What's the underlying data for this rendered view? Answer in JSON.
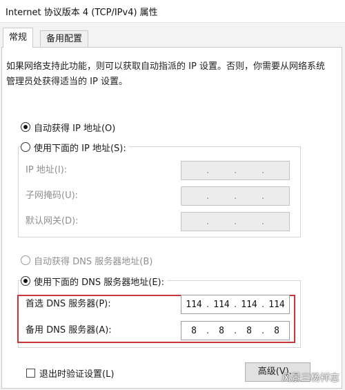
{
  "window": {
    "title": "Internet 协议版本 4 (TCP/IPv4) 属性"
  },
  "tabs": [
    {
      "label": "常规"
    },
    {
      "label": "备用配置"
    }
  ],
  "description": "如果网络支持此功能，则可以获取自动指派的 IP 设置。否则，你需要从网络系统管理员处获得适当的 IP 设置。",
  "ip_section": {
    "auto_label": "自动获得 IP 地址(O)",
    "manual_label": "使用下面的 IP 地址(S):",
    "fields": [
      {
        "label": "IP 地址(I):",
        "octets": [
          "",
          "",
          "",
          ""
        ]
      },
      {
        "label": "子网掩码(U):",
        "octets": [
          "",
          "",
          "",
          ""
        ]
      },
      {
        "label": "默认网关(D):",
        "octets": [
          "",
          "",
          "",
          ""
        ]
      }
    ]
  },
  "dns_section": {
    "auto_label": "自动获得 DNS 服务器地址(B)",
    "manual_label": "使用下面的 DNS 服务器地址(E):",
    "preferred": {
      "label": "首选 DNS 服务器(P):",
      "octets": [
        "114",
        "114",
        "114",
        "114"
      ]
    },
    "alternate": {
      "label": "备用 DNS 服务器(A):",
      "octets": [
        "8",
        "8",
        "8",
        "8"
      ]
    }
  },
  "validate_label": "退出时验证设置(L)",
  "advanced_button": "高级(V)...",
  "watermark": "风景三杨祥志",
  "colors": {
    "highlight_border": "#c8363b"
  }
}
